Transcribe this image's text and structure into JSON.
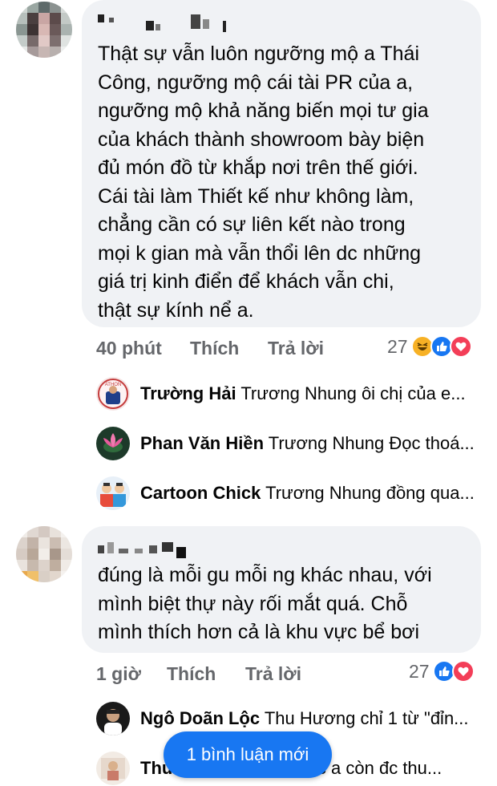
{
  "comments": [
    {
      "text": "Thật sự vẫn luôn ngưỡng mộ a Thái\nCông, ngưỡng mộ cái tài PR của a,\nngưỡng mộ khả năng biến mọi tư gia\ncủa khách thành showroom bày biện\nđủ món đồ từ khắp nơi trên thế giới.\nCái tài làm Thiết kế như không làm,\nchẳng cần có sự liên kết nào trong\nmọi k gian mà vẫn thổi lên dc những\ngiá trị kinh điển để khách vẫn chi,\nthật sự kính nể a.",
      "time": "40 phút",
      "like_label": "Thích",
      "reply_label": "Trả lời",
      "reaction_count": "27",
      "reactions": [
        "haha-icon",
        "like-icon",
        "love-icon"
      ],
      "replies": [
        {
          "name": "Trường Hải",
          "message": "Trương Nhung ôi chị của e..."
        },
        {
          "name": "Phan Văn Hiền",
          "message": "Trương Nhung Đọc thoá..."
        },
        {
          "name": "Cartoon Chick",
          "message": "Trương Nhung đồng qua..."
        }
      ]
    },
    {
      "text": "đúng là mỗi gu mỗi ng khác nhau, với\nmình biệt thự này rối mắt quá. Chỗ\nmình thích hơn cả là khu vực bể bơi",
      "time": "1 giờ",
      "like_label": "Thích",
      "reply_label": "Trả lời",
      "reaction_count": "27",
      "reactions": [
        "like-icon",
        "love-icon"
      ],
      "replies": [
        {
          "name": "Ngô Doãn Lộc",
          "message": "Thu Hương chỉ 1 từ \"đỉn..."
        },
        {
          "name": "Thu",
          "message": "Lộc  a còn đc thu..."
        }
      ]
    }
  ],
  "new_comments_label": "1 bình luận mới",
  "colors": {
    "accent": "#1877f2",
    "bubble": "#f0f2f5",
    "muted": "#65676b",
    "love": "#f33e58",
    "haha": "#f7b125"
  }
}
